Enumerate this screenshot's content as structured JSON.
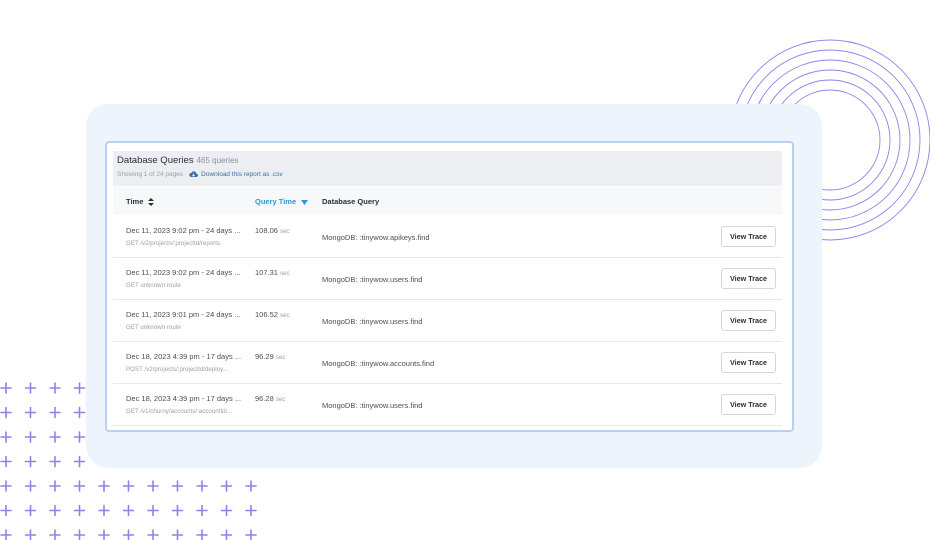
{
  "panel": {
    "title": "Database Queries",
    "query_count": "465 queries",
    "pagination": "Showing 1 of 24 pages",
    "download_label": "Download this report as .csv",
    "download_icon": "cloud-download-icon"
  },
  "columns": {
    "time": "Time",
    "query_time": "Query Time",
    "database_query": "Database Query"
  },
  "rows": [
    {
      "time": "Dec 11, 2023 9:02 pm - 24 days ...",
      "route": "GET /v2/projects/:projectId/reports",
      "query_time": "108.06",
      "unit": "sec",
      "db_query": "MongoDB: :tinywow.apikeys.find",
      "action": "View Trace"
    },
    {
      "time": "Dec 11, 2023 9:02 pm - 24 days ...",
      "route": "GET unknown route",
      "query_time": "107.31",
      "unit": "sec",
      "db_query": "MongoDB: :tinywow.users.find",
      "action": "View Trace"
    },
    {
      "time": "Dec 11, 2023 9:01 pm - 24 days ...",
      "route": "GET unknown route",
      "query_time": "106.52",
      "unit": "sec",
      "db_query": "MongoDB: :tinywow.users.find",
      "action": "View Trace"
    },
    {
      "time": "Dec 18, 2023 4:39 pm - 17 days ...",
      "route": "POST /v2/projects/:projectId/deploy...",
      "query_time": "96.29",
      "unit": "sec",
      "db_query": "MongoDB: :tinywow.accounts.find",
      "action": "View Trace"
    },
    {
      "time": "Dec 18, 2023 4:39 pm - 17 days ...",
      "route": "GET /v1/churny/accounts/:accountId/...",
      "query_time": "96.28",
      "unit": "sec",
      "db_query": "MongoDB: :tinywow.users.find",
      "action": "View Trace"
    }
  ],
  "colors": {
    "accent": "#2a9bd6",
    "card_border": "#b9d0ee",
    "backdrop": "#eef4fc",
    "decoration": "#8a86e8"
  }
}
